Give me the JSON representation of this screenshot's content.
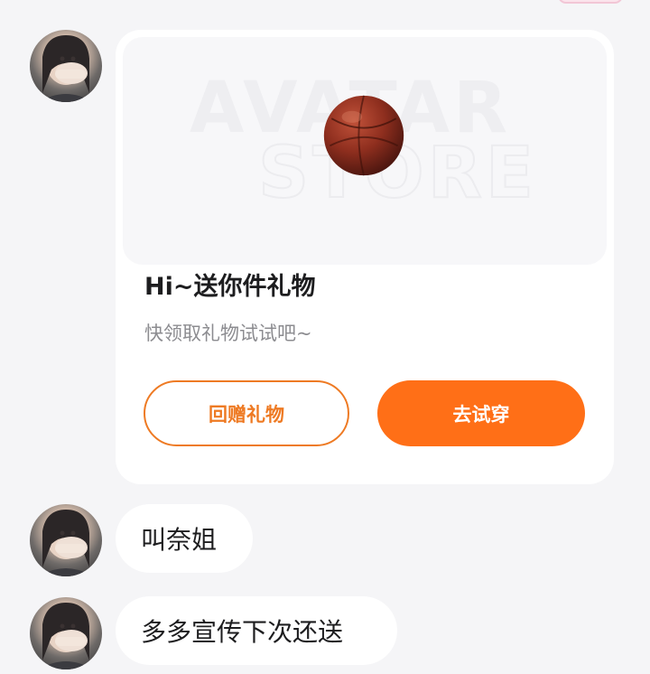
{
  "messages": [
    {
      "type": "gift_card",
      "banner_watermark": [
        "AVATAR",
        "STORE"
      ],
      "banner_icon": "basketball-icon",
      "title": "Hi~送你件礼物",
      "subtitle": "快领取礼物试试吧~",
      "buttons": {
        "return_gift": "回赠礼物",
        "try_on": "去试穿"
      }
    },
    {
      "type": "text",
      "text": "叫奈姐"
    },
    {
      "type": "text",
      "text": "多多宣传下次还送"
    }
  ],
  "colors": {
    "accent": "#ff6f17",
    "accent_outline": "#ee7a23",
    "background": "#f5f5f7",
    "bubble": "#ffffff"
  }
}
